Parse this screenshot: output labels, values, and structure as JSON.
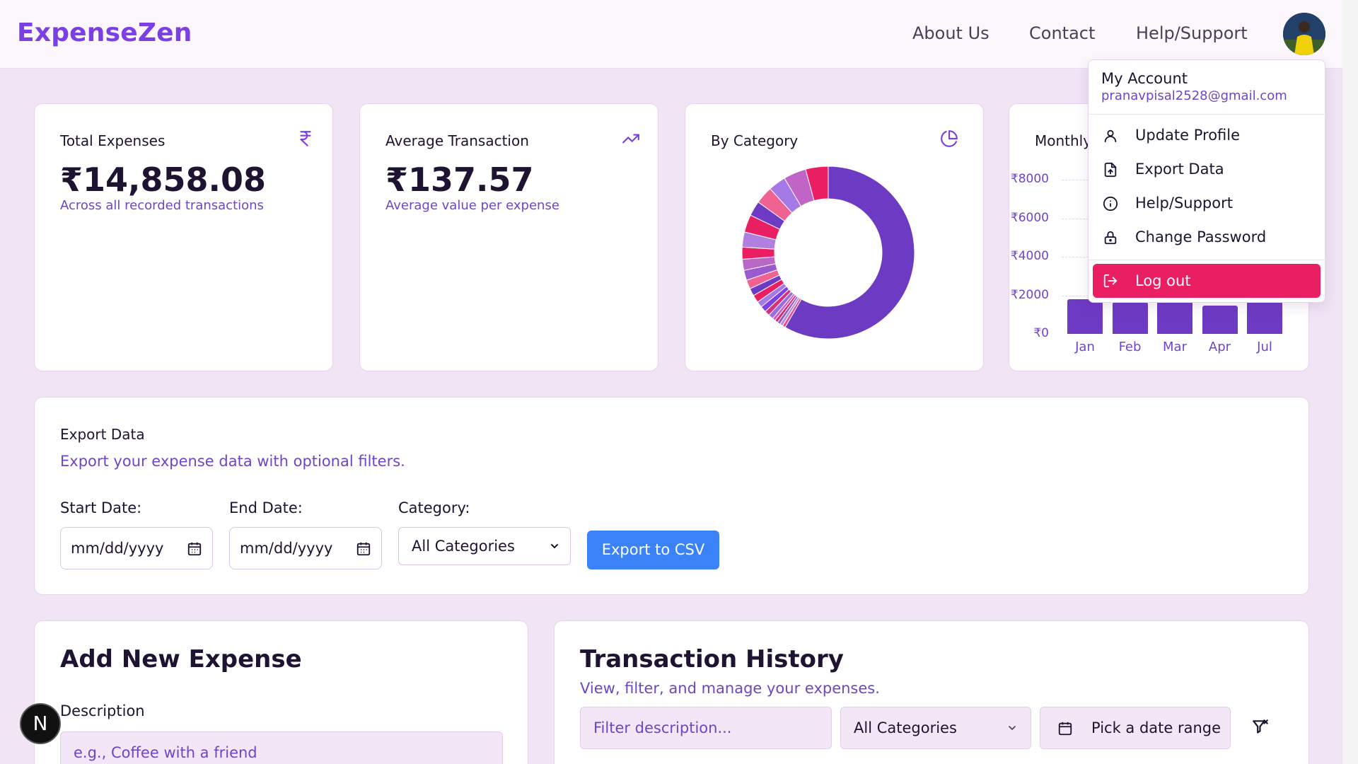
{
  "app": {
    "name": "ExpenseZen"
  },
  "nav": {
    "about": "About Us",
    "contact": "Contact",
    "help": "Help/Support"
  },
  "account_menu": {
    "heading": "My Account",
    "email": "pranavpisal2528@gmail.com",
    "items": [
      {
        "label": "Update Profile",
        "icon": "user-icon"
      },
      {
        "label": "Export Data",
        "icon": "file-export-icon"
      },
      {
        "label": "Help/Support",
        "icon": "info-icon"
      },
      {
        "label": "Change Password",
        "icon": "lock-icon"
      },
      {
        "label": "Log out",
        "icon": "logout-icon"
      }
    ]
  },
  "cards": {
    "total": {
      "title": "Total Expenses",
      "value": "₹14,858.08",
      "subtitle": "Across all recorded transactions",
      "icon": "rupee-icon"
    },
    "average": {
      "title": "Average Transaction",
      "value": "₹137.57",
      "subtitle": "Average value per expense",
      "icon": "trending-up-icon"
    },
    "category": {
      "title": "By Category",
      "icon": "pie-chart-icon"
    },
    "monthly": {
      "title": "Monthly"
    }
  },
  "chart_data": [
    {
      "type": "pie",
      "title": "By Category",
      "slices": [
        {
          "value": 62,
          "color": "#6d3ac4"
        },
        {
          "value": 0.6,
          "color": "#e64a91"
        },
        {
          "value": 0.6,
          "color": "#b98adf"
        },
        {
          "value": 0.6,
          "color": "#8b5cd6"
        },
        {
          "value": 0.6,
          "color": "#e91e63"
        },
        {
          "value": 0.6,
          "color": "#c45bd0"
        },
        {
          "value": 1.0,
          "color": "#9c6de0"
        },
        {
          "value": 1.0,
          "color": "#d9307a"
        },
        {
          "value": 1.2,
          "color": "#7b3fe4"
        },
        {
          "value": 1.2,
          "color": "#a57ae6"
        },
        {
          "value": 1.5,
          "color": "#e91e63"
        },
        {
          "value": 1.5,
          "color": "#6d3ac4"
        },
        {
          "value": 1.8,
          "color": "#f06292"
        },
        {
          "value": 2.0,
          "color": "#9b59d0"
        },
        {
          "value": 2.2,
          "color": "#ba68c8"
        },
        {
          "value": 2.4,
          "color": "#e91e63"
        },
        {
          "value": 3.0,
          "color": "#b07fe0"
        },
        {
          "value": 3.5,
          "color": "#e91e63"
        },
        {
          "value": 3.0,
          "color": "#6d3ac4"
        },
        {
          "value": 3.5,
          "color": "#f06292"
        },
        {
          "value": 3.5,
          "color": "#a57ae6"
        },
        {
          "value": 4.5,
          "color": "#c064c8"
        },
        {
          "value": 4.5,
          "color": "#e91e63"
        }
      ]
    },
    {
      "type": "bar",
      "title": "Monthly",
      "categories": [
        "Jan",
        "Feb",
        "Mar",
        "Apr",
        "Jul"
      ],
      "values": [
        1800,
        1650,
        1700,
        1450,
        1700
      ],
      "ylim": [
        0,
        8000
      ],
      "yticks": [
        0,
        2000,
        4000,
        6000,
        8000
      ],
      "ytick_labels": [
        "₹0",
        "₹2000",
        "₹4000",
        "₹6000",
        "₹8000"
      ],
      "color": "#6d3ac4"
    }
  ],
  "export": {
    "title": "Export Data",
    "subtitle": "Export your expense data with optional filters.",
    "start_label": "Start Date:",
    "end_label": "End Date:",
    "category_label": "Category:",
    "start_value": "mm/dd/yyyy",
    "end_value": "mm/dd/yyyy",
    "category_value": "All Categories",
    "button": "Export to CSV"
  },
  "add_expense": {
    "title": "Add New Expense",
    "description_label": "Description",
    "description_placeholder": "e.g., Coffee with a friend"
  },
  "history": {
    "title": "Transaction History",
    "subtitle": "View, filter, and manage your expenses.",
    "filter_placeholder": "Filter description...",
    "category_value": "All Categories",
    "date_range": "Pick a date range"
  },
  "badge": {
    "letter": "N"
  }
}
